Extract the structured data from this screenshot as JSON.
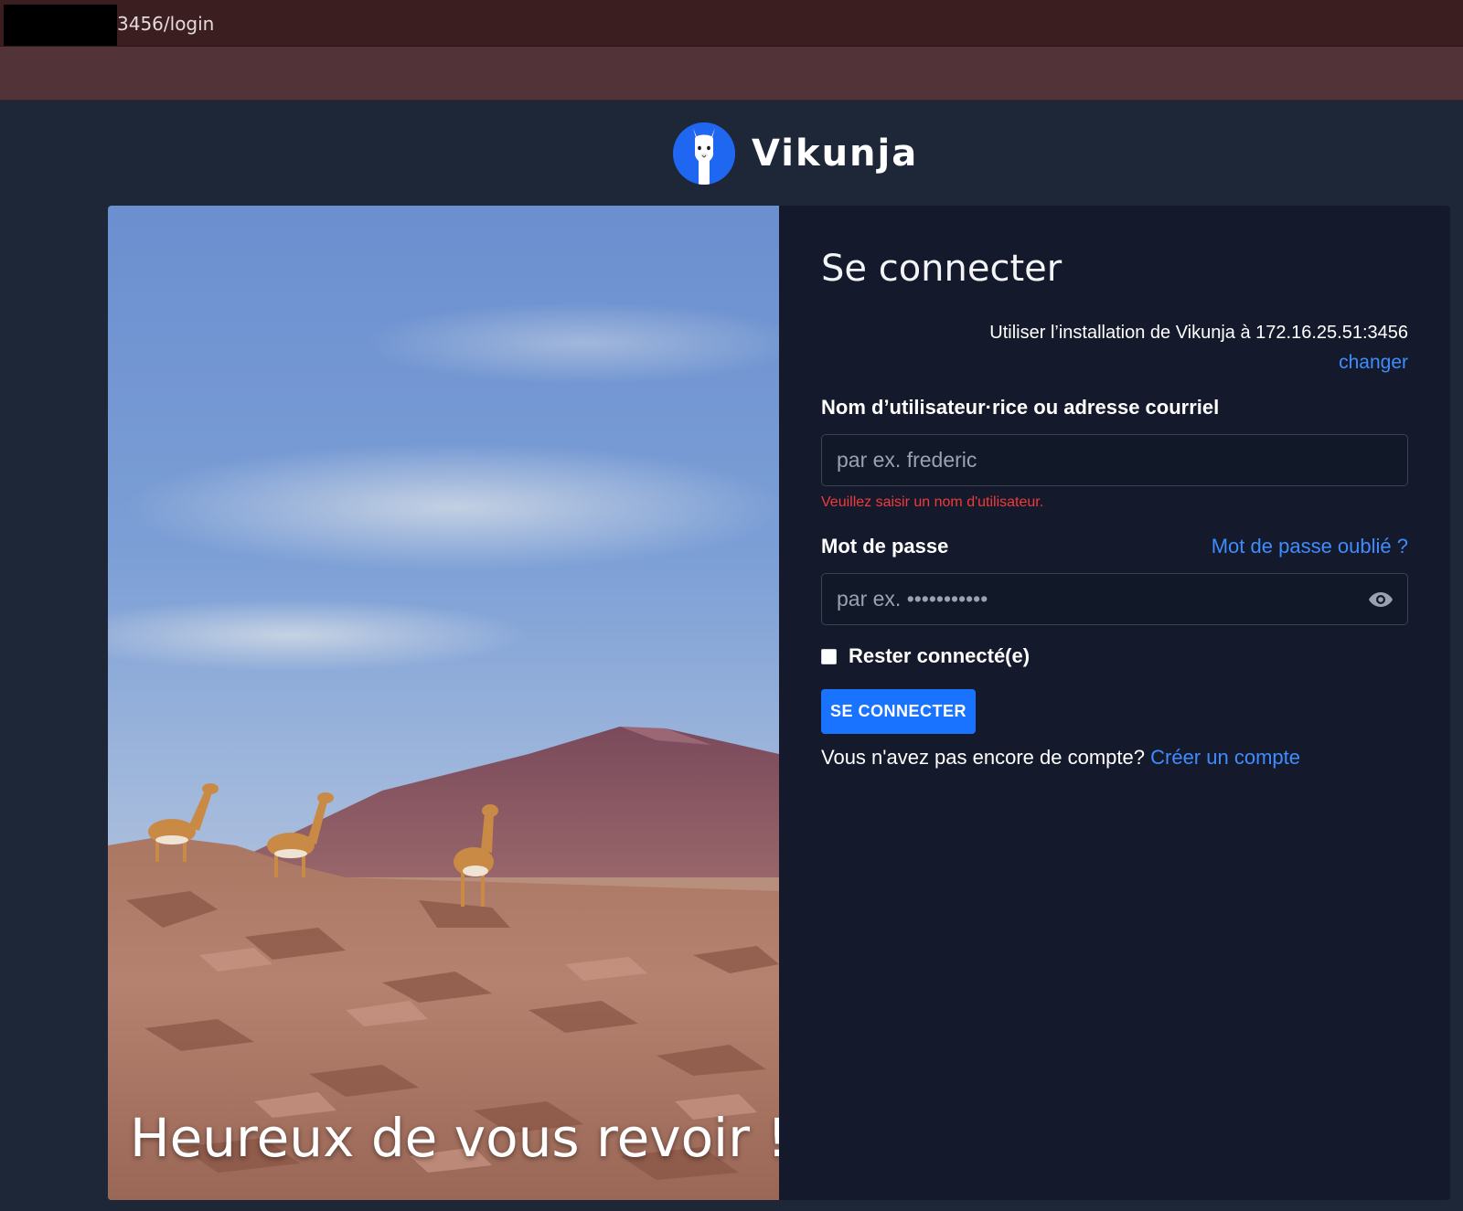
{
  "browser": {
    "url": "3456/login"
  },
  "brand": {
    "name": "Vikunja",
    "logo_icon": "llama-logo-icon",
    "logo_color": "#1f66f0"
  },
  "hero": {
    "caption": "Heureux de vous revoir !",
    "image": "vicunas-in-desert-photo"
  },
  "login": {
    "title": "Se connecter",
    "install_text": "Utiliser l’installation de Vikunja à 172.16.25.51:3456",
    "change_link": "changer",
    "username_label": "Nom d’utilisateur·rice ou adresse courriel",
    "username_placeholder": "par ex. frederic",
    "username_error": "Veuillez saisir un nom d'utilisateur.",
    "password_label": "Mot de passe",
    "forgot_link": "Mot de passe oublié ?",
    "password_placeholder": "par ex. •••••••••••",
    "password_toggle_icon": "eye-icon",
    "remember_label": "Rester connecté(e)",
    "remember_checked": false,
    "submit_label": "SE CONNECTER",
    "no_account_text": "Vous n'avez pas encore de compte?",
    "register_link": "Créer un compte"
  },
  "colors": {
    "page_background": "#1e2738",
    "card_background": "#141a2b",
    "accent": "#1973ff",
    "link": "#3f8cff",
    "error": "#ef3b3b"
  }
}
